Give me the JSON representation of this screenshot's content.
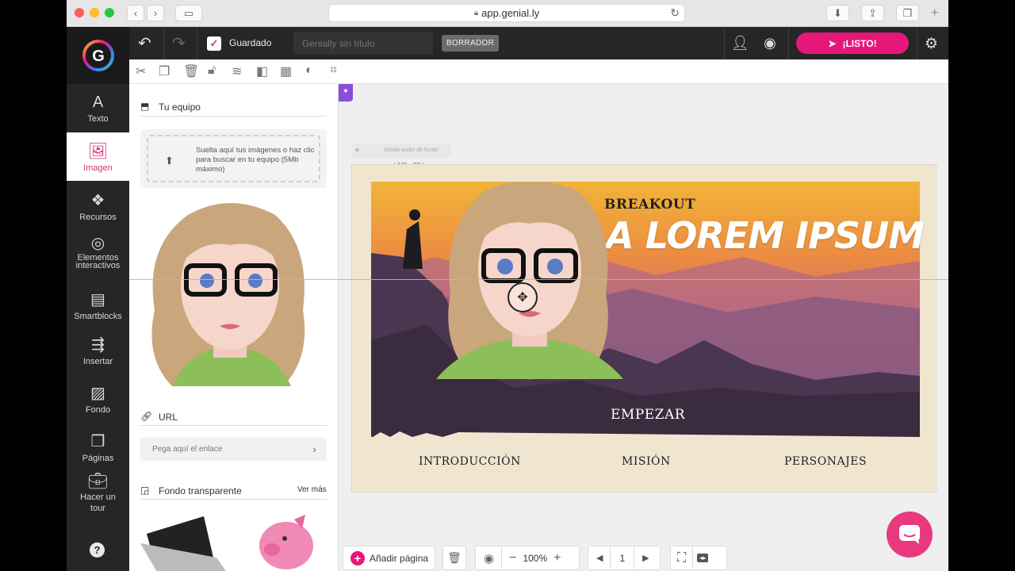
{
  "browser": {
    "url": "app.genial.ly"
  },
  "topbar": {
    "status": "Guardado",
    "title_placeholder": "Genially sin título",
    "draft_badge": "BORRADOR",
    "ready_button": "¡LISTO!"
  },
  "rail": {
    "items": [
      {
        "label": "Texto"
      },
      {
        "label": "Imagen"
      },
      {
        "label": "Recursos"
      },
      {
        "label": "Elementos interactivos"
      },
      {
        "label": "Smartblocks"
      },
      {
        "label": "Insertar"
      },
      {
        "label": "Fondo"
      },
      {
        "label": "Páginas"
      },
      {
        "label": "Hacer un tour"
      }
    ],
    "help": "?"
  },
  "panel": {
    "team_heading": "Tu equipo",
    "dropzone_text": "Suelta aquí tus imágenes o haz clic para buscar en tu equipo (5Mb máximo)",
    "url_heading": "URL",
    "url_placeholder": "Pega aquí el enlace",
    "transparent_heading": "Fondo transparente",
    "see_more": "Ver más"
  },
  "canvas": {
    "audio_label": "Añade audio de fondo",
    "coords": "( 171 , 37 )",
    "slide": {
      "kicker": "BREAKOUT",
      "title": "A LOREM IPSUM",
      "start": "EMPEZAR",
      "nav": [
        "INTRODUCCIÓN",
        "MISIÓN",
        "PERSONAJES"
      ]
    }
  },
  "bottombar": {
    "add_page": "Añadir página",
    "zoom": "100%",
    "page": "1"
  },
  "colors": {
    "accent": "#e6177a",
    "dark": "#262626",
    "guide": "#5fd8e3"
  }
}
